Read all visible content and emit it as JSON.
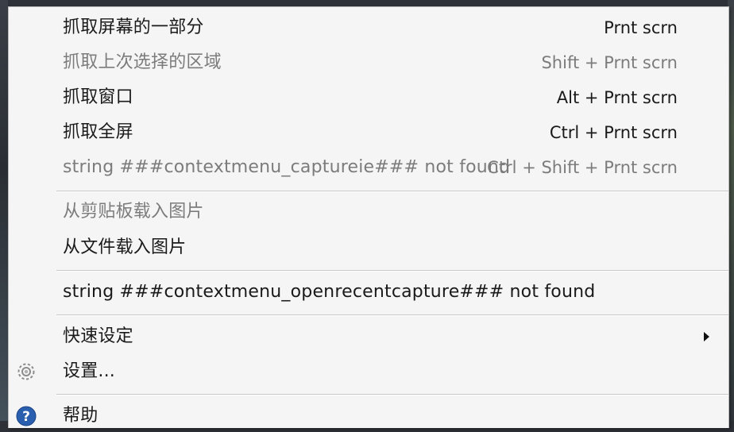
{
  "menu": {
    "items": [
      {
        "label": "抓取屏幕的一部分",
        "shortcut": "Prnt scrn"
      },
      {
        "label": "抓取上次选择的区域",
        "shortcut": "Shift + Prnt scrn"
      },
      {
        "label": "抓取窗口",
        "shortcut": "Alt + Prnt scrn"
      },
      {
        "label": "抓取全屏",
        "shortcut": "Ctrl + Prnt scrn"
      },
      {
        "label": "string ###contextmenu_captureie### not found",
        "shortcut": "Ctrl + Shift + Prnt scrn"
      },
      {
        "label": "从剪贴板载入图片"
      },
      {
        "label": "从文件载入图片"
      },
      {
        "label": "string ###contextmenu_openrecentcapture### not found"
      },
      {
        "label": "快速设定"
      },
      {
        "label": "设置..."
      },
      {
        "label": "帮助"
      }
    ],
    "icons": {
      "settings": "gear-icon",
      "help": "help-icon",
      "submenu": "chevron-right-icon"
    },
    "colors": {
      "background": "#f5f5f5",
      "text": "#1a1a1a",
      "disabled_text": "#7c7c7c",
      "help_icon": "#2a5fb0"
    }
  }
}
